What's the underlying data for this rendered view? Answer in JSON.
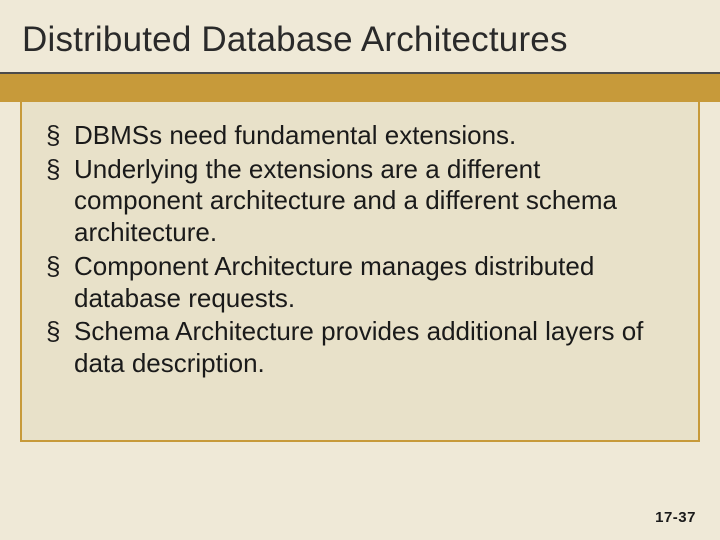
{
  "slide": {
    "title": "Distributed Database Architectures",
    "bullets": [
      "DBMSs need fundamental extensions.",
      "Underlying the extensions are a different component architecture and a different schema architecture.",
      "Component Architecture manages distributed database requests.",
      "Schema Architecture provides additional layers of data description."
    ],
    "footer": "17-37"
  }
}
